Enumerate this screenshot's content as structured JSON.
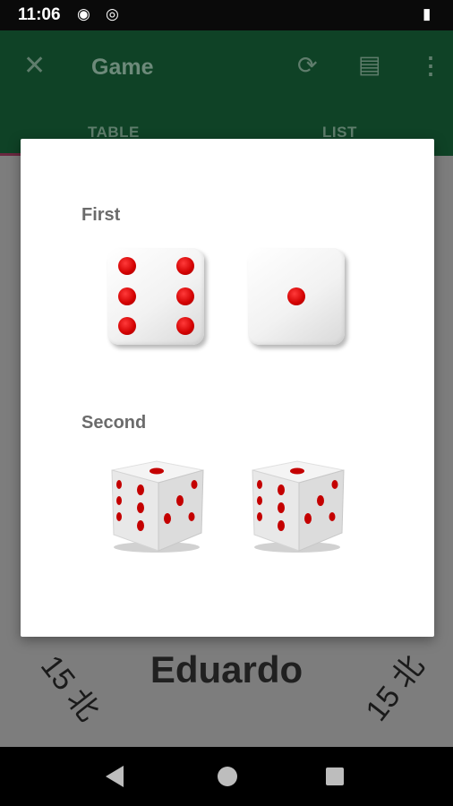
{
  "status_bar": {
    "time": "11:06",
    "icons": [
      "pocket-cast-icon",
      "target-icon",
      "battery-charging-icon"
    ]
  },
  "app_bar": {
    "title": "Game",
    "close_icon": "close-icon",
    "actions": [
      "rotate-icon",
      "history-icon",
      "more-vert-icon"
    ],
    "tabs": [
      {
        "label": "TABLE",
        "selected": true
      },
      {
        "label": "LIST",
        "selected": false
      }
    ],
    "accent_color": "#6a2840"
  },
  "background": {
    "player_name": "Eduardo",
    "left_score": "15",
    "left_direction": "北",
    "right_score": "15",
    "right_direction": "北"
  },
  "dialog": {
    "first_label": "First",
    "first_dice": [
      6,
      1
    ],
    "second_label": "Second",
    "second_dice": [
      5,
      5
    ],
    "pip_color": "#d10000"
  },
  "nav_bar": {
    "buttons": [
      "back-icon",
      "home-icon",
      "recents-icon"
    ]
  }
}
